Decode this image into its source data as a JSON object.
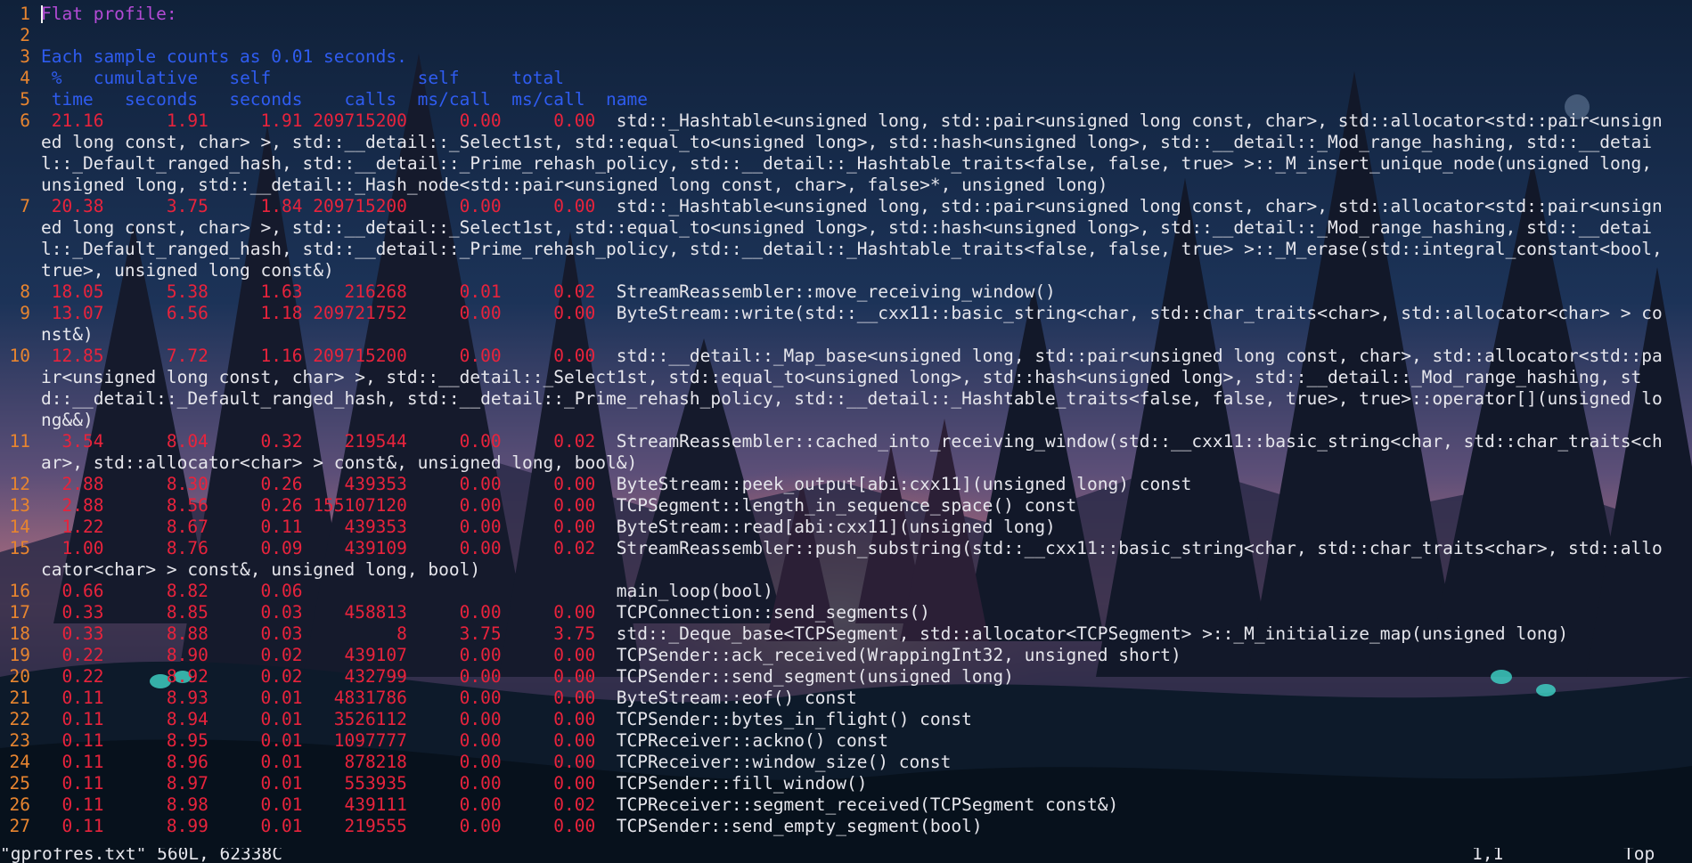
{
  "title_line": "Flat profile:",
  "sample_line": "Each sample counts as 0.01 seconds.",
  "header1": " %   cumulative   self              self     total           ",
  "header2": " time   seconds   seconds    calls  ms/call  ms/call  name    ",
  "entries": [
    {
      "ln": "6",
      "pct": "21.16",
      "cum": "1.91",
      "self": "1.91",
      "calls": "209715200",
      "selfms": "0.00",
      "totalms": "0.00",
      "name": "std::_Hashtable<unsigned long, std::pair<unsigned long const, char>, std::allocator<std::pair<unsigned long const, char> >, std::__detail::_Select1st, std::equal_to<unsigned long>, std::hash<unsigned long>, std::__detail::_Mod_range_hashing, std::__detail::_Default_ranged_hash, std::__detail::_Prime_rehash_policy, std::__detail::_Hashtable_traits<false, false, true> >::_M_insert_unique_node(unsigned long, unsigned long, std::__detail::_Hash_node<std::pair<unsigned long const, char>, false>*, unsigned long)"
    },
    {
      "ln": "7",
      "pct": "20.38",
      "cum": "3.75",
      "self": "1.84",
      "calls": "209715200",
      "selfms": "0.00",
      "totalms": "0.00",
      "name": "std::_Hashtable<unsigned long, std::pair<unsigned long const, char>, std::allocator<std::pair<unsigned long const, char> >, std::__detail::_Select1st, std::equal_to<unsigned long>, std::hash<unsigned long>, std::__detail::_Mod_range_hashing, std::__detail::_Default_ranged_hash, std::__detail::_Prime_rehash_policy, std::__detail::_Hashtable_traits<false, false, true> >::_M_erase(std::integral_constant<bool, true>, unsigned long const&)"
    },
    {
      "ln": "8",
      "pct": "18.05",
      "cum": "5.38",
      "self": "1.63",
      "calls": "216268",
      "selfms": "0.01",
      "totalms": "0.02",
      "name": "StreamReassembler::move_receiving_window()"
    },
    {
      "ln": "9",
      "pct": "13.07",
      "cum": "6.56",
      "self": "1.18",
      "calls": "209721752",
      "selfms": "0.00",
      "totalms": "0.00",
      "name": "ByteStream::write(std::__cxx11::basic_string<char, std::char_traits<char>, std::allocator<char> > const&)"
    },
    {
      "ln": "10",
      "pct": "12.85",
      "cum": "7.72",
      "self": "1.16",
      "calls": "209715200",
      "selfms": "0.00",
      "totalms": "0.00",
      "name": "std::__detail::_Map_base<unsigned long, std::pair<unsigned long const, char>, std::allocator<std::pair<unsigned long const, char> >, std::__detail::_Select1st, std::equal_to<unsigned long>, std::hash<unsigned long>, std::__detail::_Mod_range_hashing, std::__detail::_Default_ranged_hash, std::__detail::_Prime_rehash_policy, std::__detail::_Hashtable_traits<false, false, true>, true>::operator[](unsigned long&&)"
    },
    {
      "ln": "11",
      "pct": "3.54",
      "cum": "8.04",
      "self": "0.32",
      "calls": "219544",
      "selfms": "0.00",
      "totalms": "0.02",
      "name": "StreamReassembler::cached_into_receiving_window(std::__cxx11::basic_string<char, std::char_traits<char>, std::allocator<char> > const&, unsigned long, bool&)"
    },
    {
      "ln": "12",
      "pct": "2.88",
      "cum": "8.30",
      "self": "0.26",
      "calls": "439353",
      "selfms": "0.00",
      "totalms": "0.00",
      "name": "ByteStream::peek_output[abi:cxx11](unsigned long) const"
    },
    {
      "ln": "13",
      "pct": "2.88",
      "cum": "8.56",
      "self": "0.26",
      "calls": "155107120",
      "selfms": "0.00",
      "totalms": "0.00",
      "name": "TCPSegment::length_in_sequence_space() const"
    },
    {
      "ln": "14",
      "pct": "1.22",
      "cum": "8.67",
      "self": "0.11",
      "calls": "439353",
      "selfms": "0.00",
      "totalms": "0.00",
      "name": "ByteStream::read[abi:cxx11](unsigned long)"
    },
    {
      "ln": "15",
      "pct": "1.00",
      "cum": "8.76",
      "self": "0.09",
      "calls": "439109",
      "selfms": "0.00",
      "totalms": "0.02",
      "name": "StreamReassembler::push_substring(std::__cxx11::basic_string<char, std::char_traits<char>, std::allocator<char> > const&, unsigned long, bool)"
    },
    {
      "ln": "16",
      "pct": "0.66",
      "cum": "8.82",
      "self": "0.06",
      "calls": "",
      "selfms": "",
      "totalms": "",
      "name": "main_loop(bool)"
    },
    {
      "ln": "17",
      "pct": "0.33",
      "cum": "8.85",
      "self": "0.03",
      "calls": "458813",
      "selfms": "0.00",
      "totalms": "0.00",
      "name": "TCPConnection::send_segments()"
    },
    {
      "ln": "18",
      "pct": "0.33",
      "cum": "8.88",
      "self": "0.03",
      "calls": "8",
      "selfms": "3.75",
      "totalms": "3.75",
      "name": "std::_Deque_base<TCPSegment, std::allocator<TCPSegment> >::_M_initialize_map(unsigned long)"
    },
    {
      "ln": "19",
      "pct": "0.22",
      "cum": "8.90",
      "self": "0.02",
      "calls": "439107",
      "selfms": "0.00",
      "totalms": "0.00",
      "name": "TCPSender::ack_received(WrappingInt32, unsigned short)"
    },
    {
      "ln": "20",
      "pct": "0.22",
      "cum": "8.92",
      "self": "0.02",
      "calls": "432799",
      "selfms": "0.00",
      "totalms": "0.00",
      "name": "TCPSender::send_segment(unsigned long)"
    },
    {
      "ln": "21",
      "pct": "0.11",
      "cum": "8.93",
      "self": "0.01",
      "calls": "4831786",
      "selfms": "0.00",
      "totalms": "0.00",
      "name": "ByteStream::eof() const"
    },
    {
      "ln": "22",
      "pct": "0.11",
      "cum": "8.94",
      "self": "0.01",
      "calls": "3526112",
      "selfms": "0.00",
      "totalms": "0.00",
      "name": "TCPSender::bytes_in_flight() const"
    },
    {
      "ln": "23",
      "pct": "0.11",
      "cum": "8.95",
      "self": "0.01",
      "calls": "1097777",
      "selfms": "0.00",
      "totalms": "0.00",
      "name": "TCPReceiver::ackno() const"
    },
    {
      "ln": "24",
      "pct": "0.11",
      "cum": "8.96",
      "self": "0.01",
      "calls": "878218",
      "selfms": "0.00",
      "totalms": "0.00",
      "name": "TCPReceiver::window_size() const"
    },
    {
      "ln": "25",
      "pct": "0.11",
      "cum": "8.97",
      "self": "0.01",
      "calls": "553935",
      "selfms": "0.00",
      "totalms": "0.00",
      "name": "TCPSender::fill_window()"
    },
    {
      "ln": "26",
      "pct": "0.11",
      "cum": "8.98",
      "self": "0.01",
      "calls": "439111",
      "selfms": "0.00",
      "totalms": "0.02",
      "name": "TCPReceiver::segment_received(TCPSegment const&)"
    },
    {
      "ln": "27",
      "pct": "0.11",
      "cum": "8.99",
      "self": "0.01",
      "calls": "219555",
      "selfms": "0.00",
      "totalms": "0.00",
      "name": "TCPSender::send_empty_segment(bool)"
    }
  ],
  "status": {
    "file": "\"gprofres.txt\" 560L, 62338C",
    "position": "1,1",
    "scroll": "Top"
  },
  "colors": {
    "line_number": "#e8852f",
    "blue_text": "#2f5cf0",
    "purple_text": "#b44bd6",
    "numbers": "#e8233c",
    "names": "#e6e6ec"
  }
}
